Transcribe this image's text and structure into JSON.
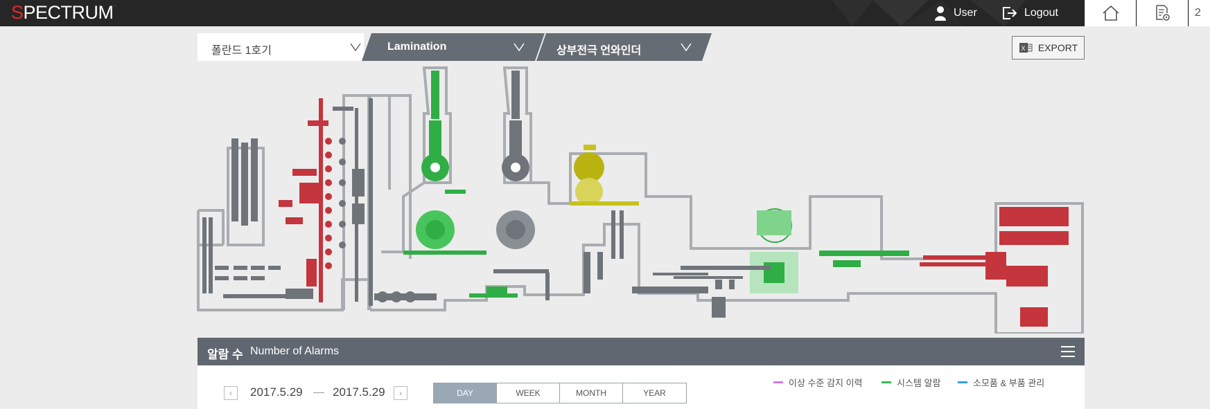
{
  "header": {
    "logo_s": "S",
    "logo_rest": "PECTRUM",
    "user_label": "User",
    "logout_label": "Logout",
    "home_icon": "home-icon",
    "report_icon": "report-settings-icon",
    "extra_label": "2"
  },
  "filters": {
    "plant": "폴란드 1호기",
    "process": "Lamination",
    "equipment": "상부전극 언와인더",
    "export_label": "EXPORT"
  },
  "alarms": {
    "title_kr": "알람 수",
    "title_en": "Number of Alarms",
    "date_from": "2017.5.29",
    "date_to": "2017.5.29",
    "periods": [
      "DAY",
      "WEEK",
      "MONTH",
      "YEAR"
    ],
    "active_period": "DAY",
    "legend": [
      {
        "label": "이상 수준 감지 이력",
        "color": "#c77ee0"
      },
      {
        "label": "시스템 알람",
        "color": "#3bb85a"
      },
      {
        "label": "소모품 & 부품 관리",
        "color": "#3a9ee0"
      }
    ]
  },
  "colors": {
    "topbar": "#262626",
    "gray_machine": "#6f747a",
    "green_machine": "#2fae45",
    "yellow_machine": "#c6c21e",
    "red_machine": "#c4353d",
    "wall": "#a9adb2"
  }
}
